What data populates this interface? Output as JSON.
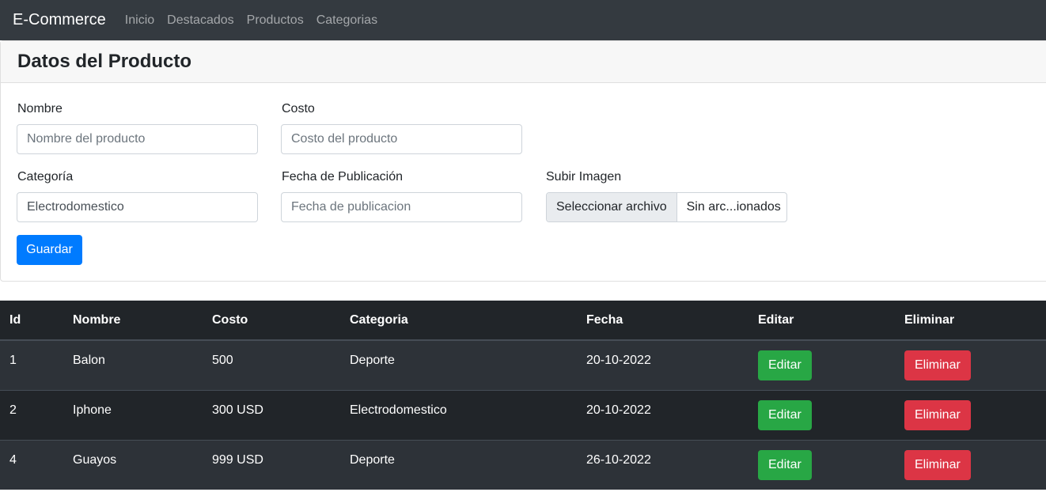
{
  "navbar": {
    "brand": "E-Commerce",
    "links": [
      "Inicio",
      "Destacados",
      "Productos",
      "Categorias"
    ]
  },
  "form": {
    "title": "Datos del Producto",
    "nombre": {
      "label": "Nombre",
      "placeholder": "Nombre del producto",
      "value": ""
    },
    "costo": {
      "label": "Costo",
      "placeholder": "Costo del producto",
      "value": ""
    },
    "categoria": {
      "label": "Categoría",
      "placeholder": "",
      "value": "Electrodomestico"
    },
    "fecha": {
      "label": "Fecha de Publicación",
      "placeholder": "Fecha de publicacion",
      "value": ""
    },
    "imagen": {
      "label": "Subir Imagen",
      "button": "Seleccionar archivo",
      "file_name": "Sin arc...ionados"
    },
    "save_label": "Guardar"
  },
  "table": {
    "headers": [
      "Id",
      "Nombre",
      "Costo",
      "Categoria",
      "Fecha",
      "Editar",
      "Eliminar"
    ],
    "edit_label": "Editar",
    "delete_label": "Eliminar",
    "rows": [
      {
        "id": "1",
        "nombre": "Balon",
        "costo": "500",
        "categoria": "Deporte",
        "fecha": "20-10-2022"
      },
      {
        "id": "2",
        "nombre": "Iphone",
        "costo": "300 USD",
        "categoria": "Electrodomestico",
        "fecha": "20-10-2022"
      },
      {
        "id": "4",
        "nombre": "Guayos",
        "costo": "999 USD",
        "categoria": "Deporte",
        "fecha": "26-10-2022"
      }
    ]
  },
  "colors": {
    "navbar": "#343a40",
    "primary": "#007bff",
    "success": "#28a745",
    "danger": "#dc3545",
    "table_dark": "#212529"
  }
}
